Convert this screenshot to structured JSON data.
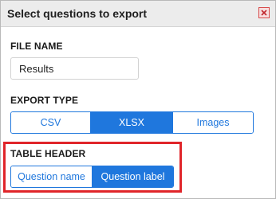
{
  "dialog": {
    "title": "Select questions to export",
    "close_icon": "close-x-icon"
  },
  "file_name": {
    "label": "FILE NAME",
    "value": "Results"
  },
  "export_type": {
    "label": "EXPORT TYPE",
    "options": [
      "CSV",
      "XLSX",
      "Images"
    ],
    "selected": "XLSX"
  },
  "table_header": {
    "label": "TABLE HEADER",
    "options": [
      "Question name",
      "Question label"
    ],
    "selected": "Question label"
  },
  "colors": {
    "accent": "#1f77dd",
    "highlight": "#e0252a"
  }
}
